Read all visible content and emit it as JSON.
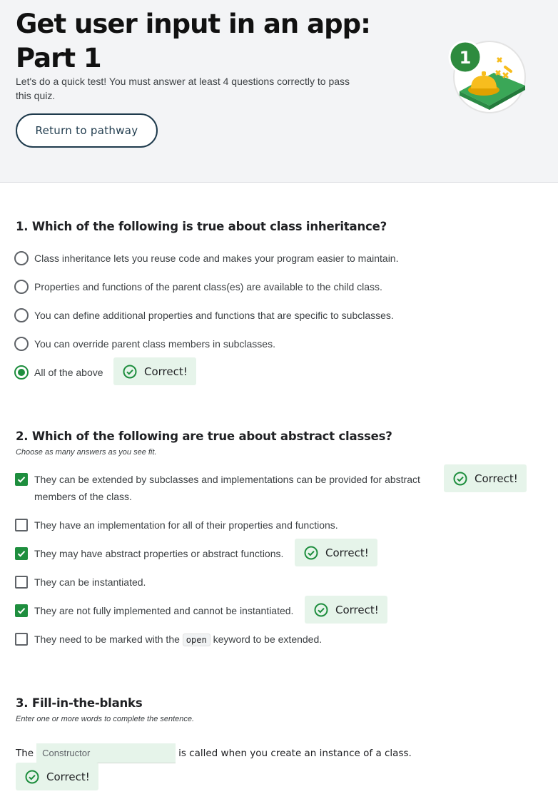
{
  "header": {
    "title": "Get user input in an app: Part 1",
    "subtitle": "Let's do a quick test! You must answer at least 4 questions correctly to pass this quiz.",
    "return_button": "Return to pathway",
    "badge_number": "1"
  },
  "feedback": {
    "correct_label": "Correct!"
  },
  "q1": {
    "title": "1. Which of the following is true about class inheritance?",
    "options": [
      "Class inheritance lets you reuse code and makes your program easier to maintain.",
      "Properties and functions of the parent class(es) are available to the child class.",
      "You can define additional properties and functions that are specific to subclasses.",
      "You can override parent class members in subclasses.",
      "All of the above"
    ],
    "selected_index": 4
  },
  "q2": {
    "title": "2. Which of the following are true about abstract classes?",
    "hint": "Choose as many answers as you see fit.",
    "options": [
      "They can be extended by subclasses and implementations can be provided for abstract members of the class.",
      "They have an implementation for all of their properties and functions.",
      "They may have abstract properties or abstract functions.",
      "They can be instantiated.",
      "They are not fully implemented and cannot be instantiated.",
      "They need to be marked with the",
      "open",
      "keyword to be extended."
    ],
    "checked": [
      true,
      false,
      true,
      false,
      true,
      false
    ]
  },
  "q3": {
    "title": "3. Fill-in-the-blanks",
    "hint": "Enter one or more words to complete the sentence.",
    "prefix": "The",
    "value": "Constructor",
    "suffix": "is called when you create an instance of a class."
  },
  "colors": {
    "accent_green": "#1e8e3e",
    "correct_bg": "#e6f4ea",
    "button_border": "#1f3b4d"
  }
}
